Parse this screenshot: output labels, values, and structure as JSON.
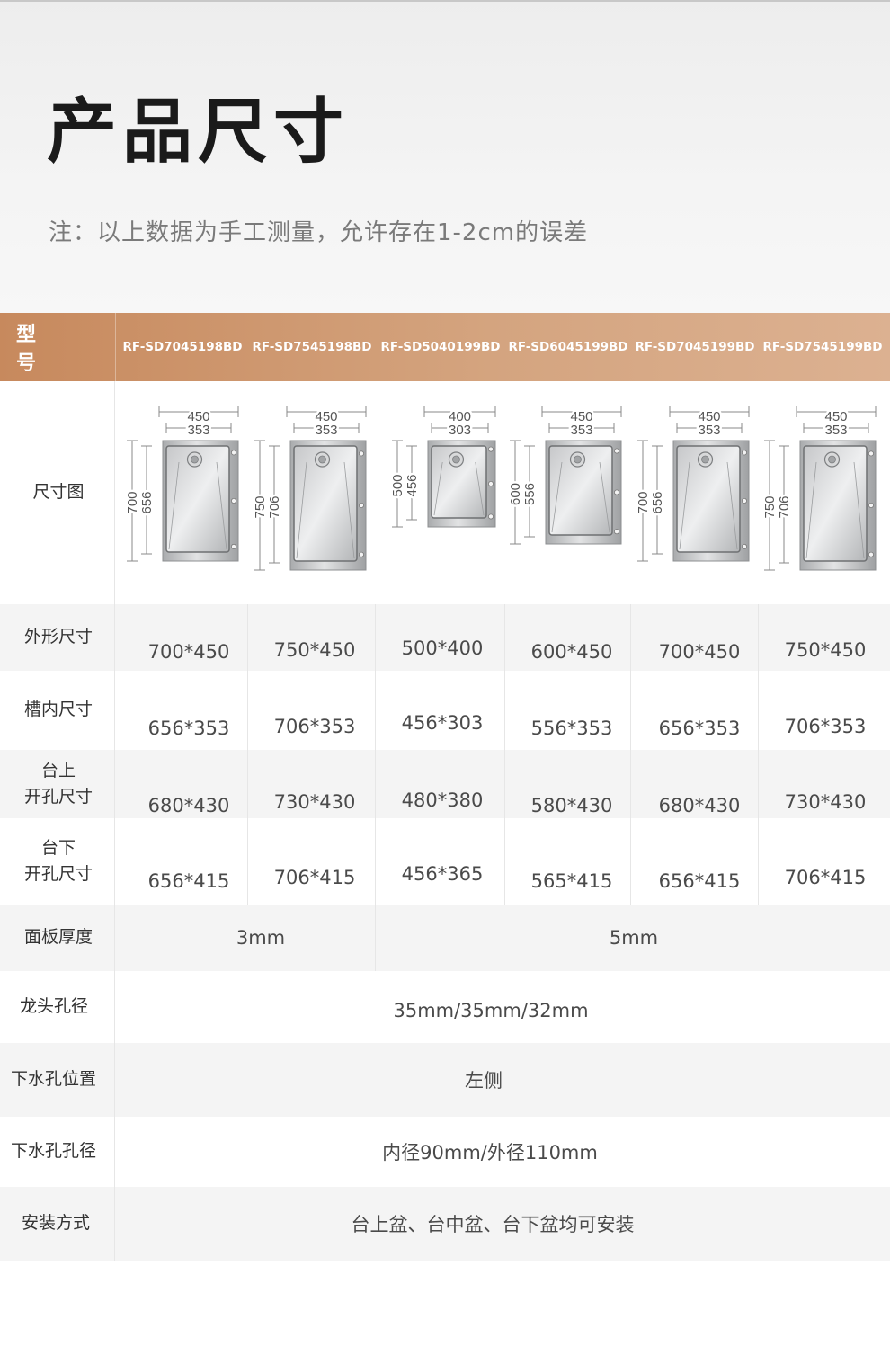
{
  "title": "产品尺寸",
  "note": "注：以上数据为手工测量，允许存在1-2cm的误差",
  "header_label": "型 号",
  "models": [
    "RF-SD7045198BD",
    "RF-SD7545198BD",
    "RF-SD5040199BD",
    "RF-SD6045199BD",
    "RF-SD7045199BD",
    "RF-SD7545199BD"
  ],
  "diagram_label": "尺寸图",
  "diagrams": [
    {
      "outer_w": "450",
      "inner_w": "353",
      "outer_l": "700",
      "inner_l": "656"
    },
    {
      "outer_w": "450",
      "inner_w": "353",
      "outer_l": "750",
      "inner_l": "706"
    },
    {
      "outer_w": "400",
      "inner_w": "303",
      "outer_l": "500",
      "inner_l": "456"
    },
    {
      "outer_w": "450",
      "inner_w": "353",
      "outer_l": "600",
      "inner_l": "556"
    },
    {
      "outer_w": "450",
      "inner_w": "353",
      "outer_l": "700",
      "inner_l": "656"
    },
    {
      "outer_w": "450",
      "inner_w": "353",
      "outer_l": "750",
      "inner_l": "706"
    }
  ],
  "rows": [
    {
      "label": "外形尺寸",
      "values": [
        "700*450",
        "750*450",
        "500*400",
        "600*450",
        "700*450",
        "750*450"
      ]
    },
    {
      "label": "槽内尺寸",
      "values": [
        "656*353",
        "706*353",
        "456*303",
        "556*353",
        "656*353",
        "706*353"
      ]
    },
    {
      "label": "台上\n开孔尺寸",
      "values": [
        "680*430",
        "730*430",
        "480*380",
        "580*430",
        "680*430",
        "730*430"
      ]
    },
    {
      "label": "台下\n开孔尺寸",
      "values": [
        "656*415",
        "706*415",
        "456*365",
        "565*415",
        "656*415",
        "706*415"
      ]
    }
  ],
  "panel_thickness": {
    "label": "面板厚度",
    "values": [
      "3mm",
      "5mm"
    ]
  },
  "faucet_hole": {
    "label": "龙头孔径",
    "value": "35mm/35mm/32mm"
  },
  "drain_position": {
    "label": "下水孔位置",
    "value": "左侧"
  },
  "drain_diameter": {
    "label": "下水孔孔径",
    "value": "内径90mm/外径110mm"
  },
  "installation": {
    "label": "安装方式",
    "value": "台上盆、台中盆、台下盆均可安装"
  },
  "colors": {
    "header_start": "#c7895d",
    "header_end": "#dcb191",
    "title": "#1a1a1a",
    "note": "#7a7a7a"
  },
  "diagram_proportions": [
    {
      "length": 700,
      "width": 450
    },
    {
      "length": 750,
      "width": 450
    },
    {
      "length": 500,
      "width": 400
    },
    {
      "length": 600,
      "width": 450
    },
    {
      "length": 700,
      "width": 450
    },
    {
      "length": 750,
      "width": 450
    }
  ]
}
